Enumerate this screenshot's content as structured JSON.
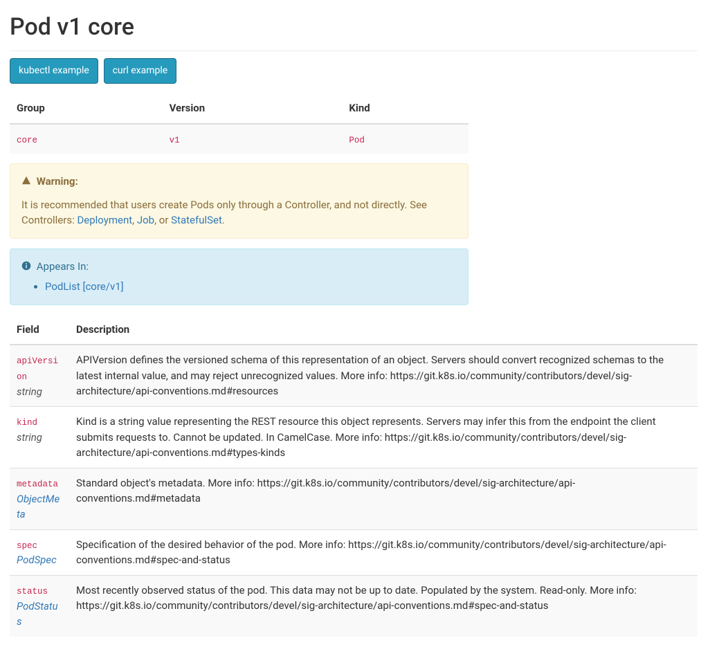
{
  "title": "Pod v1 core",
  "buttons": {
    "kubectl": "kubectl example",
    "curl": "curl example"
  },
  "gvk_headers": {
    "group": "Group",
    "version": "Version",
    "kind": "Kind"
  },
  "gvk": {
    "group": "core",
    "version": "v1",
    "kind": "Pod"
  },
  "warning_label": "Warning:",
  "warning_text_prefix": "It is recommended that users create Pods only through a Controller, and not directly. See Controllers: ",
  "warning_links": {
    "deployment": "Deployment",
    "job": "Job",
    "statefulset": "StatefulSet"
  },
  "warning_sep1": ", ",
  "warning_sep2": ", or ",
  "warning_suffix": ".",
  "appears_label": "Appears In:",
  "appears_in": [
    "PodList [core/v1]"
  ],
  "fields_headers": {
    "field": "Field",
    "description": "Description"
  },
  "fields": [
    {
      "name": "apiVersion",
      "type": "string",
      "type_link": false,
      "description": "APIVersion defines the versioned schema of this representation of an object. Servers should convert recognized schemas to the latest internal value, and may reject unrecognized values. More info: https://git.k8s.io/community/contributors/devel/sig-architecture/api-conventions.md#resources"
    },
    {
      "name": "kind",
      "type": "string",
      "type_link": false,
      "description": "Kind is a string value representing the REST resource this object represents. Servers may infer this from the endpoint the client submits requests to. Cannot be updated. In CamelCase. More info: https://git.k8s.io/community/contributors/devel/sig-architecture/api-conventions.md#types-kinds"
    },
    {
      "name": "metadata",
      "type": "ObjectMeta",
      "type_link": true,
      "description": "Standard object's metadata. More info: https://git.k8s.io/community/contributors/devel/sig-architecture/api-conventions.md#metadata"
    },
    {
      "name": "spec",
      "type": "PodSpec",
      "type_link": true,
      "description": "Specification of the desired behavior of the pod. More info: https://git.k8s.io/community/contributors/devel/sig-architecture/api-conventions.md#spec-and-status"
    },
    {
      "name": "status",
      "type": "PodStatus",
      "type_link": true,
      "description": "Most recently observed status of the pod. This data may not be up to date. Populated by the system. Read-only. More info: https://git.k8s.io/community/contributors/devel/sig-architecture/api-conventions.md#spec-and-status"
    }
  ]
}
